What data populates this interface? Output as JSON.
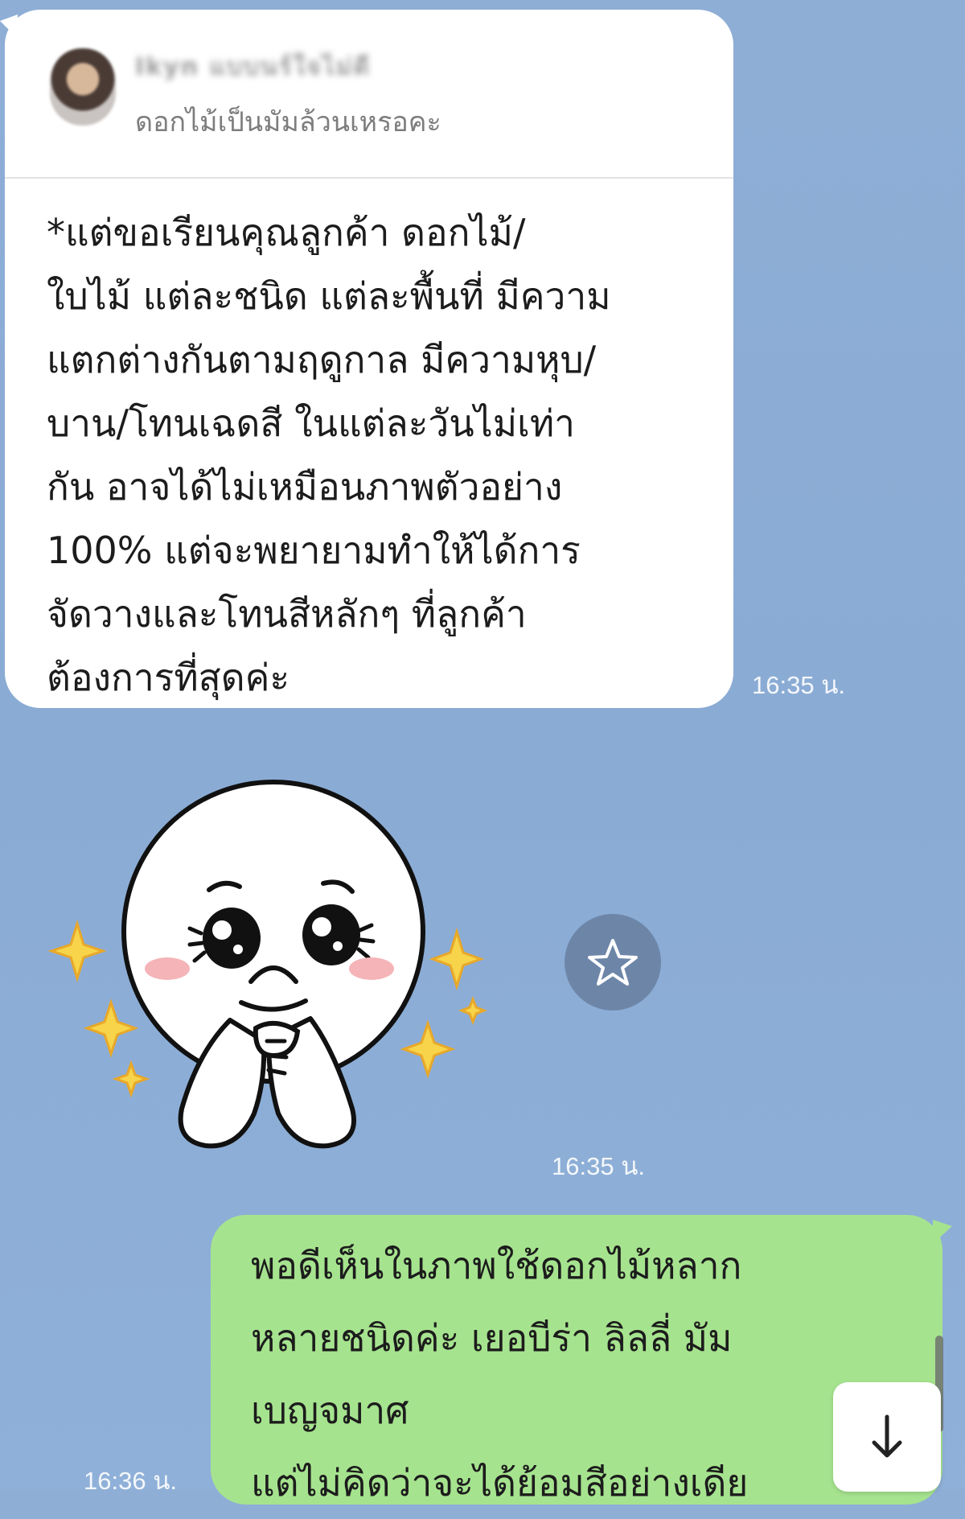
{
  "incoming": {
    "sender_name": "Ikyn แบบนร์ใจไม่ดี",
    "quoted_text": "ดอกไม้เป็นมัมล้วนเหรอคะ",
    "text": "*แต่ขอเรียนคุณลูกค้า ดอกไม้/\nใบไม้ แต่ละชนิด แต่ละพื้นที่ มีความ\nแตกต่างกันตามฤดูกาล มีความหุบ/\nบาน/โทนเฉดสี ในแต่ละวันไม่เท่า\nกัน อาจได้ไม่เหมือนภาพตัวอย่าง\n100% แต่จะพยายามทำให้ได้การ\nจัดวางและโทนสีหลักๆ ที่ลูกค้า\nต้องการที่สุดค่ะ",
    "time": "16:35 น."
  },
  "sticker": {
    "icon": "moon-praying-sticker",
    "time": "16:35 น."
  },
  "outgoing": {
    "text": "พอดีเห็นในภาพใช้ดอกไม้หลาก\nหลายชนิดค่ะ เยอบีร่า ลิลลี่ มัม\nเบญจมาศ\nแต่ไม่คิดว่าจะได้ย้อมสีอย่างเดีย",
    "time": "16:36 น."
  },
  "icons": {
    "favorite": "star-outline-icon",
    "scroll_down": "arrow-down-icon"
  },
  "colors": {
    "background": "#8eaed6",
    "incoming_bubble": "#ffffff",
    "outgoing_bubble": "#a6e38f",
    "timestamp": "#f4f7fb"
  }
}
